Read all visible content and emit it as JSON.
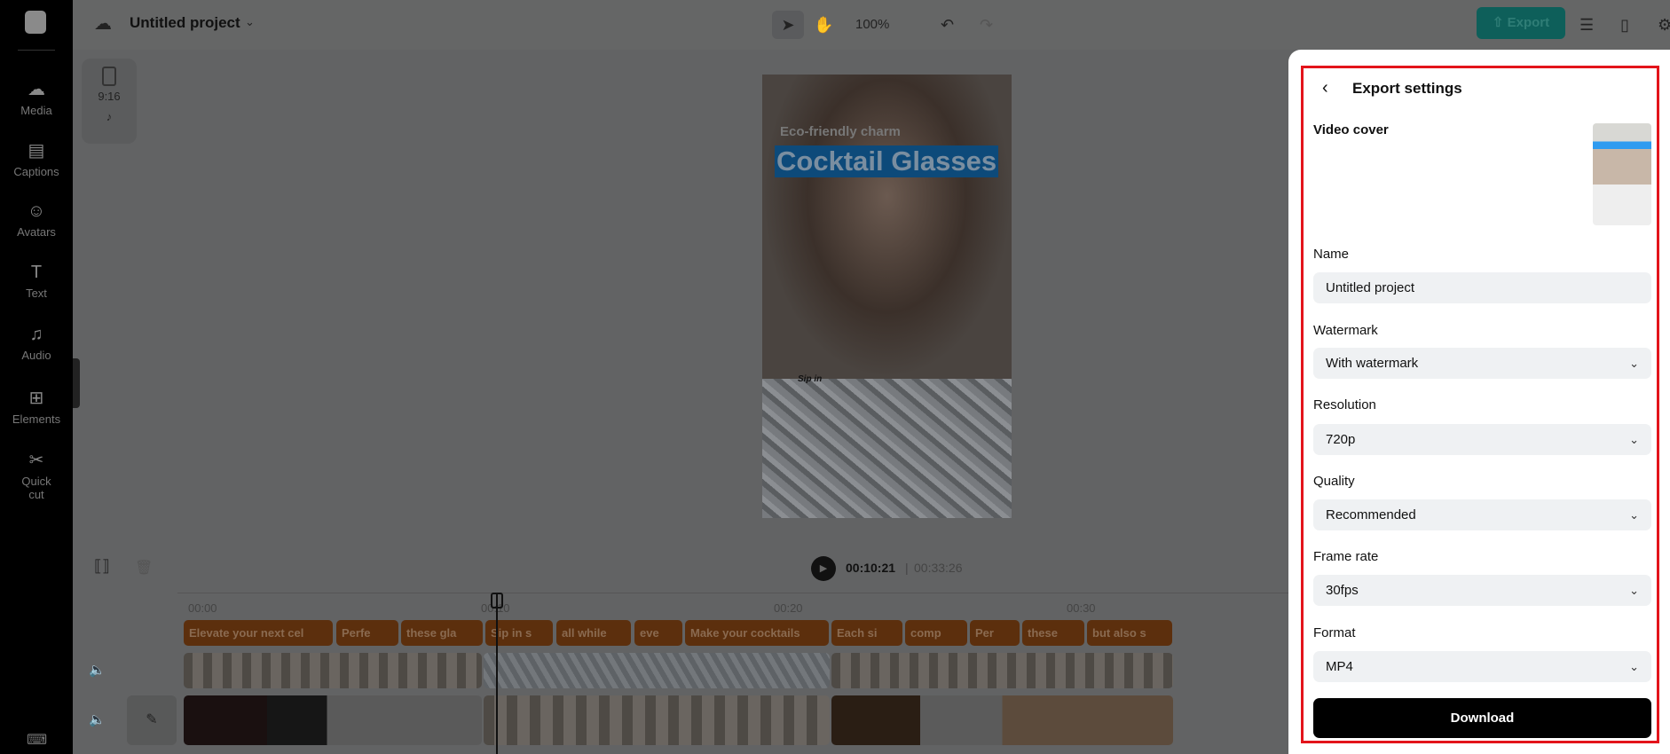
{
  "sidebar": {
    "items": [
      {
        "label": "Media",
        "icon": "cloud-upload-icon"
      },
      {
        "label": "Captions",
        "icon": "captions-icon"
      },
      {
        "label": "Avatars",
        "icon": "avatar-icon"
      },
      {
        "label": "Text",
        "icon": "text-icon"
      },
      {
        "label": "Audio",
        "icon": "music-icon"
      },
      {
        "label": "Elements",
        "icon": "elements-icon"
      },
      {
        "label": "Quick cut",
        "icon": "scissors-icon"
      }
    ]
  },
  "header": {
    "project_title": "Untitled project",
    "zoom": "100%",
    "export_label": "Export"
  },
  "canvas": {
    "ratio": "9:16",
    "subtitle_small": "Eco-friendly charm",
    "subtitle_big": "Cocktail Glasses",
    "subtitle_low": "Sip in"
  },
  "timeline": {
    "current_time": "00:10:21",
    "total_time": "00:33:26",
    "ticks": [
      "00:00",
      "00:10",
      "00:20",
      "00:30"
    ],
    "captions": [
      "Elevate your next cel",
      "Perfe",
      "these gla",
      "Sip in s",
      "all while",
      "eve",
      "Make your cocktails",
      "Each si",
      "comp",
      "Per",
      "these",
      "but also s"
    ]
  },
  "export_panel": {
    "title": "Export settings",
    "video_cover_label": "Video cover",
    "name_label": "Name",
    "name_value": "Untitled project",
    "watermark_label": "Watermark",
    "watermark_value": "With watermark",
    "resolution_label": "Resolution",
    "resolution_value": "720p",
    "quality_label": "Quality",
    "quality_value": "Recommended",
    "framerate_label": "Frame rate",
    "framerate_value": "30fps",
    "format_label": "Format",
    "format_value": "MP4",
    "download_label": "Download"
  },
  "colors": {
    "accent": "#14a89f",
    "highlight": "#e3141b",
    "caption": "#c8661a"
  }
}
